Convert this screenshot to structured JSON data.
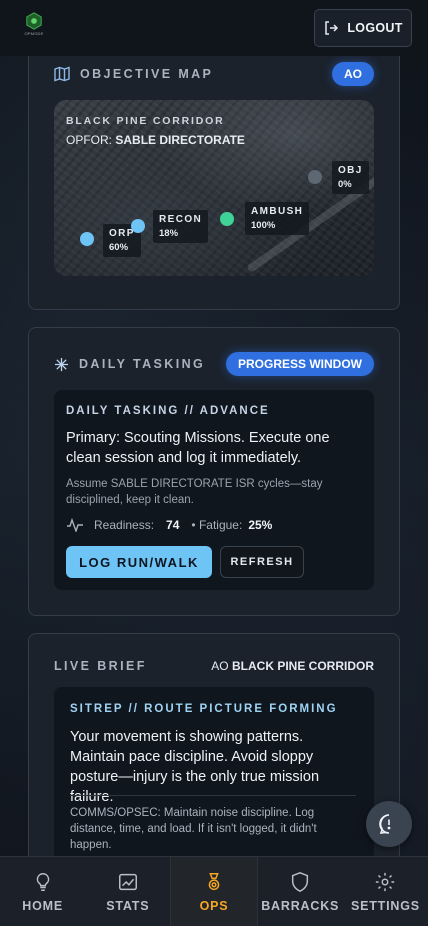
{
  "app": {
    "logo_text": "OPMODE"
  },
  "header": {
    "logout_label": "LOGOUT"
  },
  "objective_map": {
    "title": "OBJECTIVE MAP",
    "badge": "AO",
    "corridor": "BLACK PINE CORRIDOR",
    "opfor_label": "OPFOR:",
    "opfor_name": "SABLE DIRECTORATE",
    "nodes": [
      {
        "name": "ORP",
        "pct": "60%",
        "color": "#6ec4f5"
      },
      {
        "name": "RECON",
        "pct": "18%",
        "color": "#6ec4f5"
      },
      {
        "name": "AMBUSH",
        "pct": "100%",
        "color": "#3fd39a"
      },
      {
        "name": "OBJ",
        "pct": "0%",
        "color": "#5e6873"
      }
    ]
  },
  "daily_tasking": {
    "title": "DAILY TASKING",
    "badge": "PROGRESS WINDOW",
    "inner_title": "DAILY TASKING // ADVANCE",
    "primary": "Primary: Scouting Missions. Execute one clean session and log it immediately.",
    "secondary": "Assume SABLE DIRECTORATE ISR cycles—stay disciplined, keep it clean.",
    "readiness_label": "Readiness:",
    "readiness_value": "74",
    "fatigue_label": "• Fatigue:",
    "fatigue_value": "25%",
    "log_button": "LOG RUN/WALK",
    "refresh_button": "REFRESH"
  },
  "live_brief": {
    "title": "LIVE BRIEF",
    "ao_label": "AO",
    "ao_value": "BLACK PINE CORRIDOR",
    "inner_title": "SITREP // ROUTE PICTURE FORMING",
    "main_text": "Your movement is showing patterns. Maintain pace discipline. Avoid sloppy posture—injury is the only true mission failure.",
    "comms_text": "COMMS/OPSEC: Maintain noise discipline. Log distance, time, and load. If it isn't logged, it didn't happen."
  },
  "nav": {
    "items": [
      {
        "label": "HOME",
        "icon": "lightbulb-icon"
      },
      {
        "label": "STATS",
        "icon": "chart-icon"
      },
      {
        "label": "OPS",
        "icon": "medal-icon",
        "active": true
      },
      {
        "label": "BARRACKS",
        "icon": "shield-icon"
      },
      {
        "label": "SETTINGS",
        "icon": "gear-icon"
      }
    ]
  },
  "colors": {
    "accent": "#2f6fe0",
    "primary_button": "#6ec4f5",
    "nav_active": "#f5a623"
  }
}
